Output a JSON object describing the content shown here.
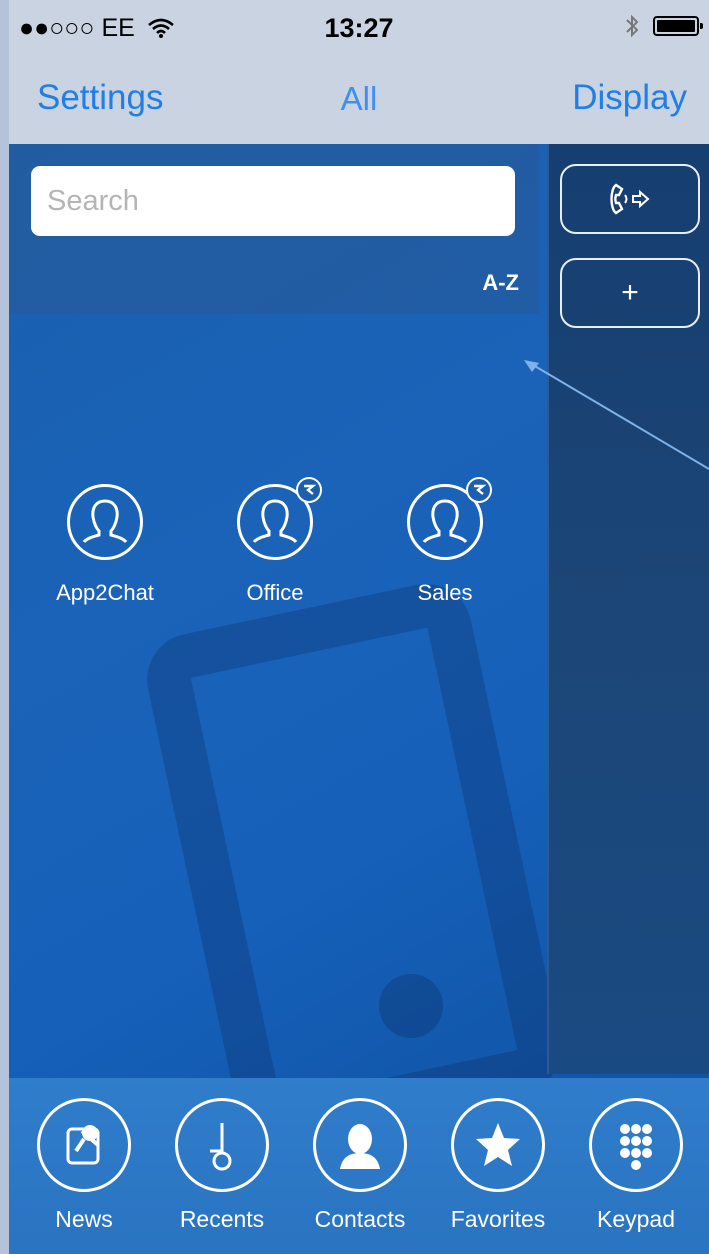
{
  "status_bar": {
    "carrier": "●●○○○ EE",
    "time": "13:27"
  },
  "nav": {
    "left": "Settings",
    "center": "All",
    "right": "Display"
  },
  "search": {
    "placeholder": "Search",
    "value": ""
  },
  "sort_label": "A-Z",
  "side_buttons": [
    {
      "icon": "phone-forward-icon"
    },
    {
      "label": "+"
    }
  ],
  "contacts": [
    {
      "name": "App2Chat",
      "badge": false
    },
    {
      "name": "Office",
      "badge": true
    },
    {
      "name": "Sales",
      "badge": true
    }
  ],
  "tabs": [
    {
      "label": "News",
      "icon": "pin-icon"
    },
    {
      "label": "Recents",
      "icon": "clock-icon"
    },
    {
      "label": "Contacts",
      "icon": "person-icon"
    },
    {
      "label": "Favorites",
      "icon": "star-icon"
    },
    {
      "label": "Keypad",
      "icon": "keypad-icon"
    }
  ],
  "colors": {
    "accent": "#1f7fe6",
    "background": "#1a63b8",
    "tabbar": "#2f7dcb"
  }
}
